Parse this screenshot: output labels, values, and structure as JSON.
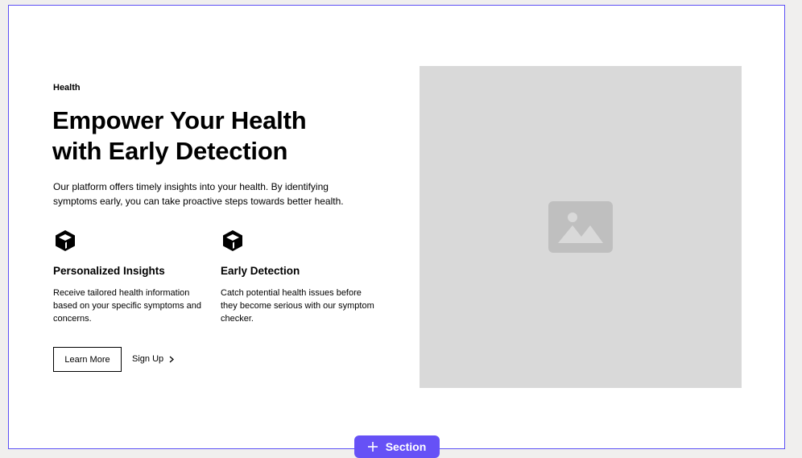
{
  "hero": {
    "tagline": "Health",
    "heading": "Empower Your Health with Early Detection",
    "intro": "Our platform offers timely insights into your health. By identifying symptoms early, you can take proactive steps towards better health.",
    "features": [
      {
        "icon": "cube-icon",
        "title": "Personalized Insights",
        "description": "Receive tailored health information based on your specific symptoms and concerns."
      },
      {
        "icon": "cube-icon",
        "title": "Early Detection",
        "description": "Catch potential health issues before they become serious with our symptom checker."
      }
    ],
    "buttons": {
      "primary_label": "Learn More",
      "secondary_label": "Sign Up"
    },
    "image": {
      "icon": "image-icon"
    }
  },
  "editor": {
    "add_section_label": "Section"
  },
  "colors": {
    "accent": "#6651f6",
    "frame": "#5b4ff5",
    "placeholder": "#d9d9d9",
    "placeholder_icon": "#bfbfbf",
    "canvas": "#f0efee"
  }
}
